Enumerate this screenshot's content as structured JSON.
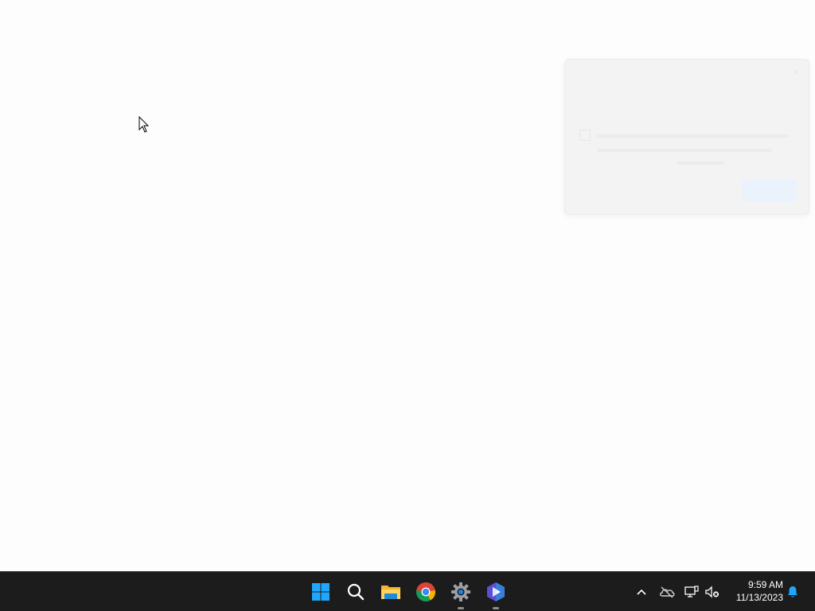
{
  "notification": {
    "title": "",
    "body": "",
    "detail": "",
    "close_label": "×",
    "button_label": ""
  },
  "taskbar": {
    "apps": [
      {
        "name": "start-button",
        "icon": "windows-logo-icon"
      },
      {
        "name": "search-button",
        "icon": "search-icon"
      },
      {
        "name": "file-explorer-button",
        "icon": "folder-icon"
      },
      {
        "name": "chrome-button",
        "icon": "chrome-icon"
      },
      {
        "name": "settings-button",
        "icon": "gear-icon",
        "running": true
      },
      {
        "name": "bing-copilot-button",
        "icon": "bing-icon",
        "running": true
      }
    ],
    "tray": {
      "overflow_icon": "chevron-up-icon",
      "icons": [
        "onedrive-offline-icon",
        "network-icon",
        "speaker-muted-icon"
      ]
    },
    "clock": {
      "time": "9:59 AM",
      "date": "11/13/2023"
    },
    "notification_icon": "bell-icon"
  },
  "colors": {
    "taskbar_bg": "#1c1c1c",
    "accent": "#1ea7fd",
    "desktop_bg": "#fdfdfd"
  }
}
